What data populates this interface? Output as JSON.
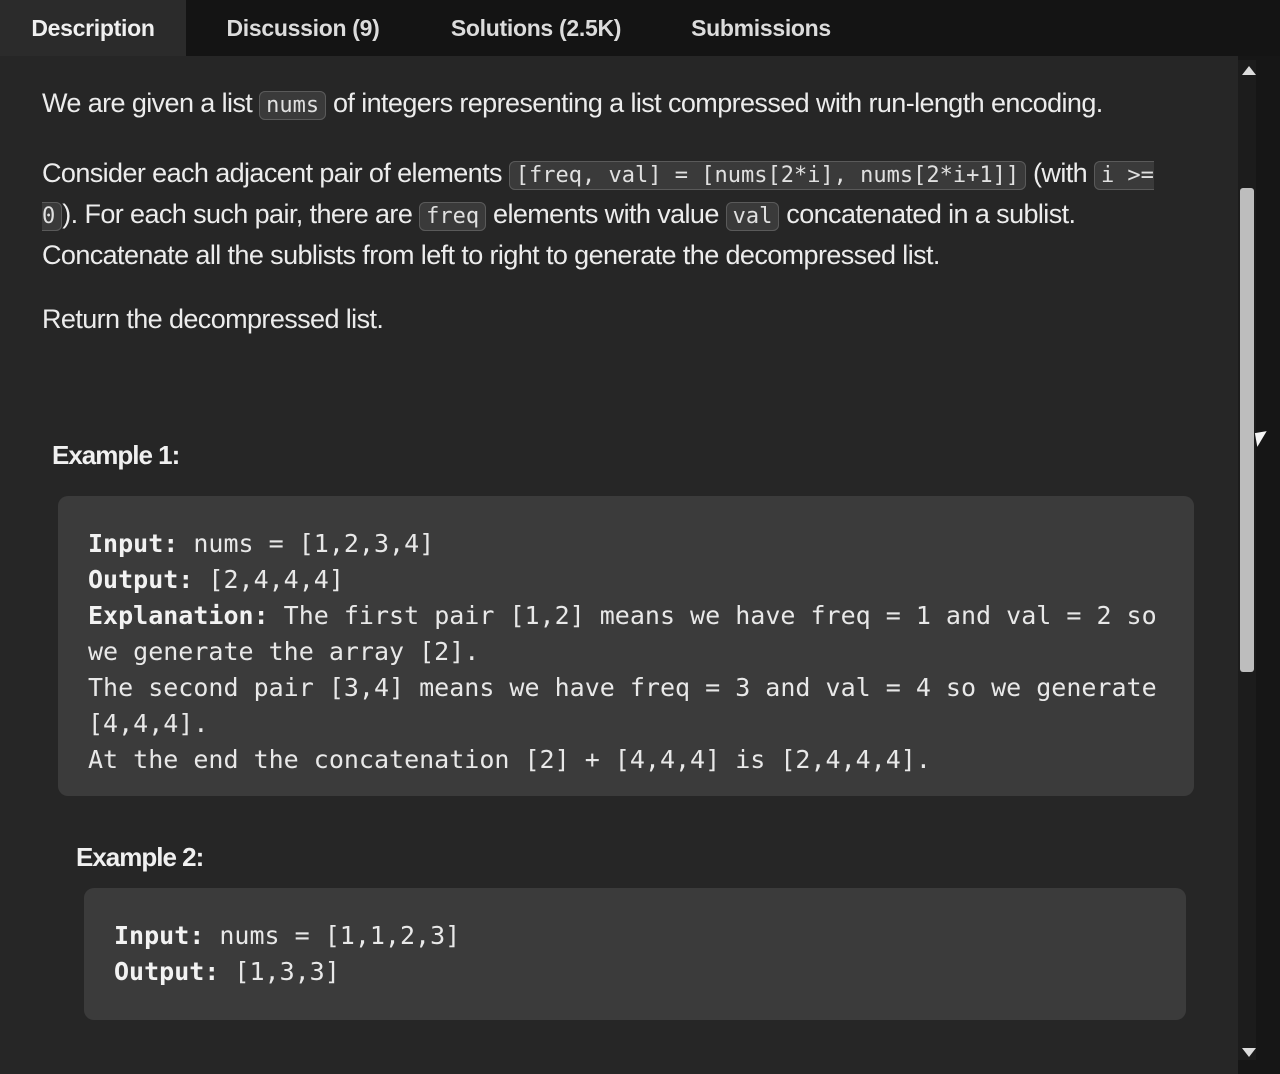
{
  "tabs": [
    {
      "label": "Description"
    },
    {
      "label": "Discussion (9)"
    },
    {
      "label": "Solutions (2.5K)"
    },
    {
      "label": "Submissions"
    }
  ],
  "problem": {
    "p1": {
      "t1": "We are given a list ",
      "c1": "nums",
      "t2": " of integers representing a list compressed with run-length encoding."
    },
    "p2": {
      "t1": "Consider each adjacent pair of elements ",
      "c1": "[freq, val] = [nums[2*i], nums[2*i+1]]",
      "t2": " (with ",
      "c2": "i >= 0",
      "t3": "). For each such pair, there are ",
      "c3": "freq",
      "t4": " elements with value ",
      "c4": "val",
      "t5": " concatenated in a sublist. Concatenate all the sublists from left to right to generate the decompressed list."
    },
    "p3": "Return the decompressed list."
  },
  "examples": [
    {
      "title": "Example 1:",
      "input_label": "Input:",
      "input": " nums = [1,2,3,4]",
      "output_label": "Output:",
      "output": " [2,4,4,4]",
      "explanation_label": "Explanation:",
      "explanation": " The first pair [1,2] means we have freq = 1 and val = 2 so we generate the array [2].\nThe second pair [3,4] means we have freq = 3 and val = 4 so we generate [4,4,4].\nAt the end the concatenation [2] + [4,4,4] is [2,4,4,4]."
    },
    {
      "title": "Example 2:",
      "input_label": "Input:",
      "input": " nums = [1,1,2,3]",
      "output_label": "Output:",
      "output": " [1,3,3]"
    }
  ]
}
